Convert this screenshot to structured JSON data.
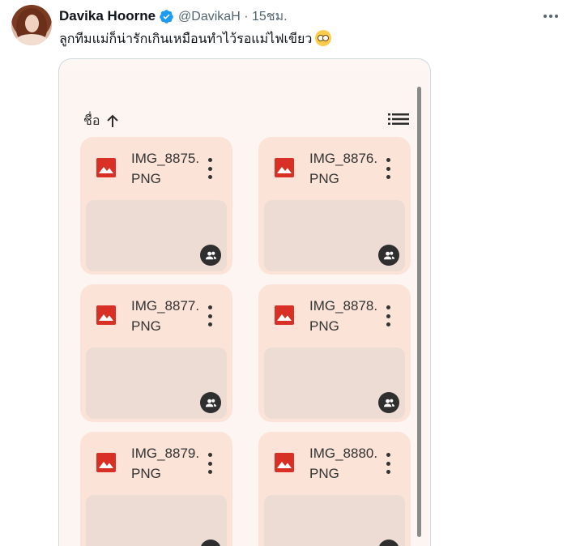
{
  "tweet": {
    "author_name": "Davika Hoorne",
    "handle_and_time": "@DavikaH · 15ชม.",
    "text": "ลูกทีมแม่ก็น่ารักเกินเหมือนทำไว้รอแม่ไฟเขียว"
  },
  "file_browser": {
    "sort_label": "ชื่อ",
    "files": [
      {
        "name": "IMG_8875.PNG"
      },
      {
        "name": "IMG_8876.PNG"
      },
      {
        "name": "IMG_8877.PNG"
      },
      {
        "name": "IMG_8878.PNG"
      },
      {
        "name": "IMG_8879.PNG"
      },
      {
        "name": "IMG_8880.PNG"
      }
    ]
  },
  "colors": {
    "verified_badge": "#1d9bf0",
    "image_icon": "#d93025",
    "card_bg": "#fbe3d8",
    "thumb_bg": "#ecdcd4"
  }
}
